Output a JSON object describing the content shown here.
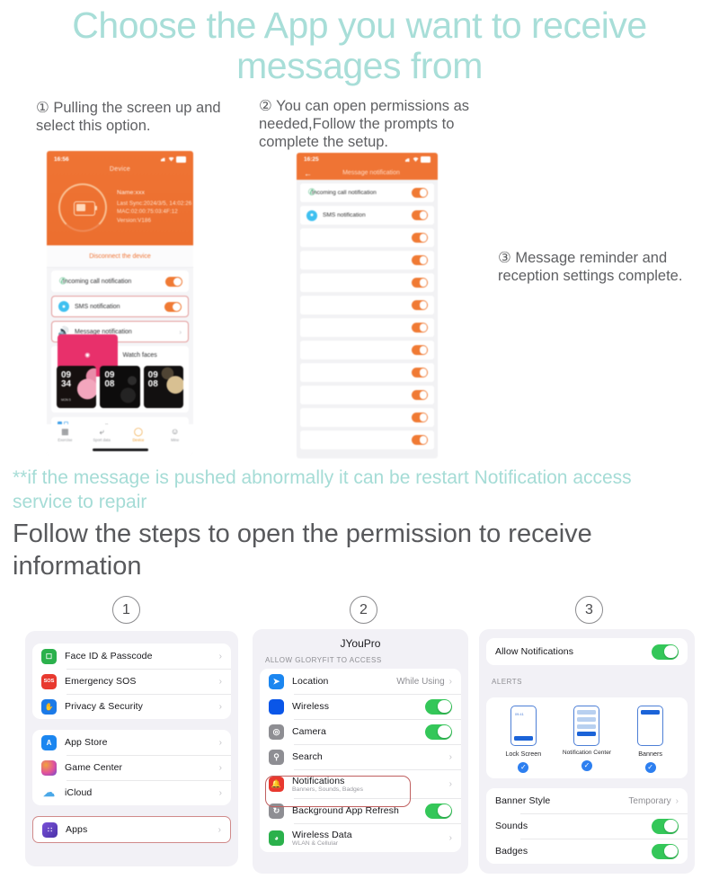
{
  "headline": "Choose the App you want to receive messages from",
  "steps": {
    "one": "① Pulling the screen up and select this option.",
    "two": "② You can open permissions as needed,Follow the prompts to complete the setup.",
    "three": "③ Message reminder and reception settings complete."
  },
  "mint_note": "**if the message is pushed abnormally it can be restart Notification access service to repair",
  "gray_heading": "Follow the steps to open the permission to receive information",
  "phone1": {
    "status_time": "16:56",
    "title": "Device",
    "info": {
      "name": "Name:xxx",
      "last_sync": "Last Sync:2024/3/5, 14:02:26",
      "mac": "MAC:02:00:75:03:4F:12",
      "version": "Version:V186"
    },
    "disconnect": "Disconnect the device",
    "rows": [
      {
        "label": "Incoming call notification",
        "icon": "phone-icon",
        "control": "toggle-on"
      },
      {
        "label": "SMS notification",
        "icon": "sms-icon",
        "control": "toggle-on",
        "selected": true
      },
      {
        "label": "Message notification",
        "icon": "speaker-icon",
        "control": "chevron",
        "selected": true
      }
    ],
    "watch_faces_label": "Watch faces",
    "faces": [
      {
        "time_top": "09",
        "time_bottom": "34",
        "date": "MON 5"
      },
      {
        "time_top": "09",
        "time_bottom": "08",
        "date": ""
      },
      {
        "time_top": "09",
        "time_bottom": "08",
        "date": ""
      }
    ],
    "custom_wallpaper": "Custom wallpaper",
    "nav": [
      {
        "label": "Exercise",
        "icon": "grid-icon",
        "active": false
      },
      {
        "label": "Sport data",
        "icon": "shoe-icon",
        "active": false
      },
      {
        "label": "Device",
        "icon": "watch-icon",
        "active": true
      },
      {
        "label": "Mine",
        "icon": "person-icon",
        "active": false
      }
    ]
  },
  "phone2": {
    "status_time": "16:25",
    "title": "Message notification",
    "back_icon": "back-arrow-icon",
    "rows": [
      {
        "label": "Incoming call notification",
        "icon": "phone-icon"
      },
      {
        "label": "SMS notification",
        "icon": "sms-icon"
      },
      {
        "label": "",
        "icon": ""
      },
      {
        "label": "",
        "icon": ""
      },
      {
        "label": "",
        "icon": ""
      },
      {
        "label": "",
        "icon": ""
      },
      {
        "label": "",
        "icon": ""
      },
      {
        "label": "",
        "icon": ""
      },
      {
        "label": "",
        "icon": ""
      },
      {
        "label": "",
        "icon": ""
      },
      {
        "label": "",
        "icon": ""
      },
      {
        "label": "",
        "icon": ""
      }
    ]
  },
  "panels": {
    "numbers": {
      "one": "1",
      "two": "2",
      "three": "3"
    },
    "p1": {
      "group_a": [
        {
          "label": "Face ID & Passcode",
          "icon": "faceid-icon",
          "color": "#2bb14c",
          "glyph": "▣"
        },
        {
          "label": "Emergency SOS",
          "icon": "sos-icon",
          "color": "#e8392f",
          "glyph": "SOS"
        },
        {
          "label": "Privacy & Security",
          "icon": "privacy-hand-icon",
          "color": "#1b7ae8",
          "glyph": "✋"
        }
      ],
      "group_b": [
        {
          "label": "App Store",
          "icon": "app-store-icon",
          "color": "#1b86f0",
          "glyph": "A"
        },
        {
          "label": "Game Center",
          "icon": "game-center-icon",
          "color": "#e05ba8",
          "glyph": "●"
        },
        {
          "label": "iCloud",
          "icon": "icloud-icon",
          "color": "#ffffff",
          "glyph": "☁"
        }
      ],
      "group_c": [
        {
          "label": "Apps",
          "icon": "apps-icon",
          "color": "#6a44c8",
          "glyph": "∷",
          "selected": true
        }
      ]
    },
    "p2": {
      "title": "JYouPro",
      "section_header": "ALLOW GLORYFIT TO ACCESS",
      "rows": [
        {
          "label": "Location",
          "icon": "location-icon",
          "color": "#1b86f0",
          "glyph": "➤",
          "value": "While Using",
          "control": "chevron"
        },
        {
          "label": "Wireless",
          "icon": "wireless-icon",
          "color": "#0a56e8",
          "glyph": "",
          "control": "toggle-on"
        },
        {
          "label": "Camera",
          "icon": "camera-icon",
          "color": "#8e8e93",
          "glyph": "◎",
          "control": "toggle-on"
        },
        {
          "label": "Search",
          "icon": "search-icon",
          "color": "#8e8e93",
          "glyph": "⌕",
          "control": "chevron"
        },
        {
          "label": "Notifications",
          "sublabel": "Banners, Sounds, Badges",
          "icon": "notifications-bell-icon",
          "color": "#e8392f",
          "glyph": "🔔",
          "control": "chevron",
          "selected": true
        },
        {
          "label": "Background App Refresh",
          "icon": "refresh-icon",
          "color": "#8e8e93",
          "glyph": "↻",
          "control": "toggle-on"
        },
        {
          "label": "Wireless Data",
          "sublabel": "WLAN & Cellular",
          "icon": "wireless-data-icon",
          "color": "#2bb14c",
          "glyph": "(•)",
          "control": "chevron"
        }
      ]
    },
    "p3": {
      "allow_label": "Allow Notifications",
      "allow_control": "toggle-on",
      "alerts_header": "ALERTS",
      "alerts": [
        {
          "label": "Lock Screen",
          "checked": true,
          "time": "09:41"
        },
        {
          "label": "Notification Center",
          "checked": true,
          "time": ""
        },
        {
          "label": "Banners",
          "checked": true,
          "time": ""
        }
      ],
      "rows": [
        {
          "label": "Banner Style",
          "value": "Temporary",
          "control": "chevron"
        },
        {
          "label": "Sounds",
          "control": "toggle-on"
        },
        {
          "label": "Badges",
          "control": "toggle-on"
        }
      ]
    }
  },
  "colors": {
    "mint": "#a8ded8",
    "orange": "#ef7434",
    "green": "#34c759",
    "select_red": "#d08a8a"
  }
}
